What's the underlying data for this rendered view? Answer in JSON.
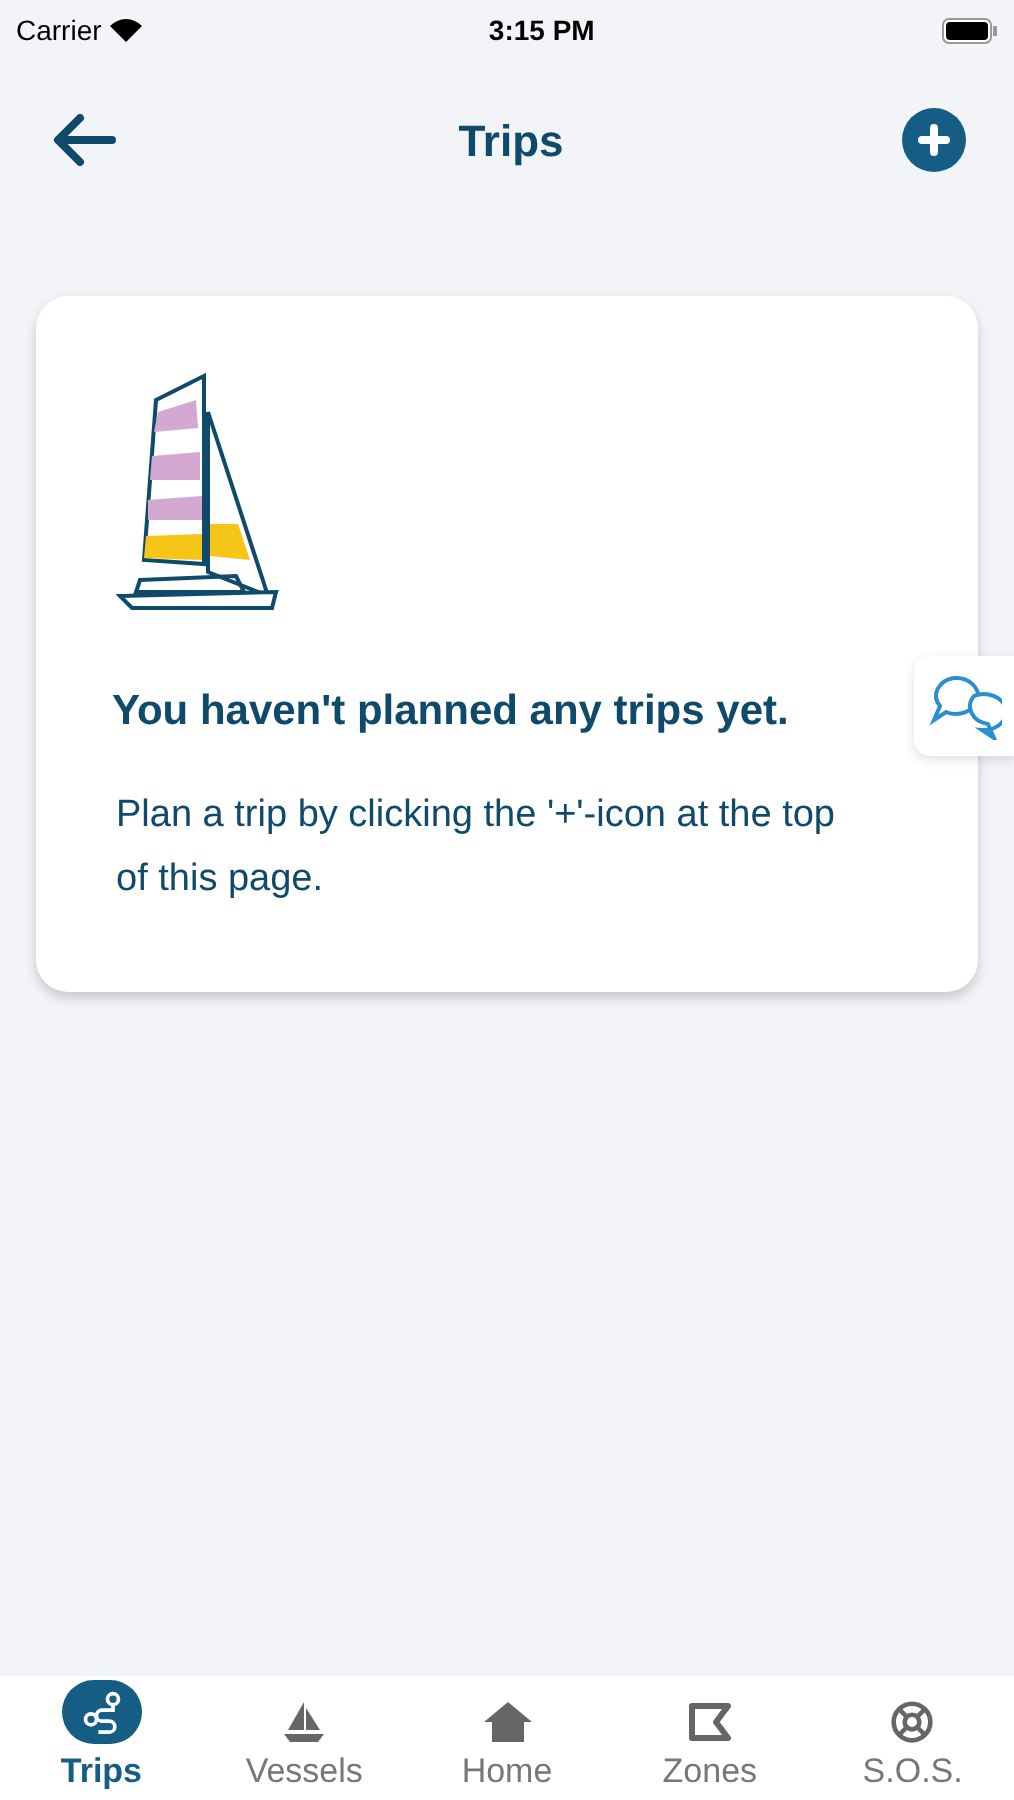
{
  "status_bar": {
    "carrier": "Carrier",
    "time": "3:15 PM"
  },
  "header": {
    "title": "Trips"
  },
  "empty_state": {
    "heading": "You haven't planned any trips yet.",
    "message": "Plan a trip by clicking the '+'-icon at the top of this page."
  },
  "tabs": [
    {
      "label": "Trips",
      "kind": "trips",
      "selected": true
    },
    {
      "label": "Vessels",
      "kind": "vessels",
      "selected": false
    },
    {
      "label": "Home",
      "kind": "home",
      "selected": false
    },
    {
      "label": "Zones",
      "kind": "zones",
      "selected": false
    },
    {
      "label": "S.O.S.",
      "kind": "sos",
      "selected": false
    }
  ]
}
